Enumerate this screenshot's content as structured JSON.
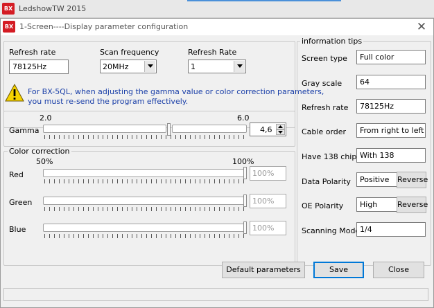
{
  "app": {
    "title": "LedshowTW 2015",
    "logo_text": "BX"
  },
  "dialog": {
    "title": "1-Screen----Display parameter configuration",
    "logo_text": "BX"
  },
  "top": {
    "refresh_rate_label": "Refresh rate",
    "refresh_rate_value": "78125Hz",
    "scan_frequency_label": "Scan frequency",
    "scan_frequency_value": "20MHz",
    "refresh_rate2_label": "Refresh Rate",
    "refresh_rate2_value": "1"
  },
  "warning": {
    "line1": "For BX-5QL, when adjusting the gamma value or color correction parameters,",
    "line2": "you must re-send the program effectively."
  },
  "gamma": {
    "label": "Gamma",
    "min_label": "2.0",
    "max_label": "6.0",
    "value": "4,6",
    "level": 0.65
  },
  "color_correction": {
    "legend": "Color correction",
    "min_label": "50%",
    "max_label": "100%",
    "channels": [
      {
        "label": "Red",
        "value": "100%",
        "level": 1.0
      },
      {
        "label": "Green",
        "value": "100%",
        "level": 1.0
      },
      {
        "label": "Blue",
        "value": "100%",
        "level": 1.0
      }
    ]
  },
  "info": {
    "legend": "information tips",
    "screen_type_label": "Screen type",
    "screen_type_value": "Full color",
    "gray_scale_label": "Gray scale",
    "gray_scale_value": "64",
    "refresh_rate_label": "Refresh rate",
    "refresh_rate_value": "78125Hz",
    "cable_order_label": "Cable order",
    "cable_order_value": "From right to left",
    "chip138_label": "Have 138 chip",
    "chip138_value": "With 138",
    "data_polarity_label": "Data Polarity",
    "data_polarity_value": "Positive",
    "data_reverse_label": "Reverse",
    "oe_polarity_label": "OE Polarity",
    "oe_polarity_value": "High",
    "oe_reverse_label": "Reverse",
    "scanning_mode_label": "Scanning Mode",
    "scanning_mode_value": "1/4"
  },
  "buttons": {
    "default_label": "Default parameters",
    "save_label": "Save",
    "close_label": "Close"
  },
  "colors": {
    "warning_text": "#1a3fa8",
    "warning_icon": "#f5d200",
    "logo_red": "#d41c24",
    "focus_blue": "#0078d7"
  }
}
